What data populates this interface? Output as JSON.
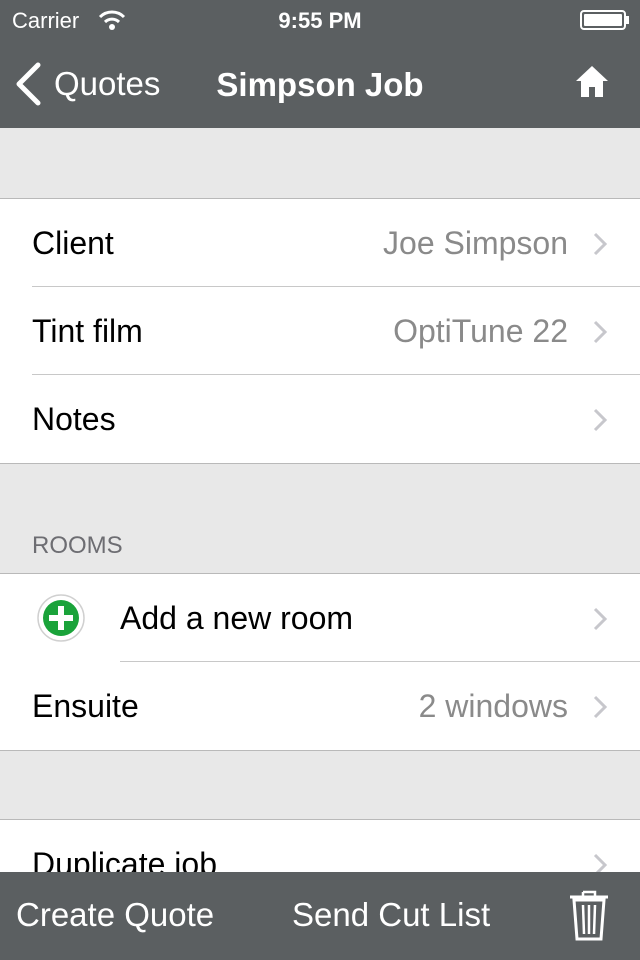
{
  "status_bar": {
    "carrier": "Carrier",
    "time": "9:55 PM"
  },
  "nav": {
    "back_label": "Quotes",
    "title": "Simpson Job"
  },
  "details": [
    {
      "label": "Client",
      "value": "Joe Simpson"
    },
    {
      "label": "Tint film",
      "value": "OptiTune 22"
    },
    {
      "label": "Notes",
      "value": ""
    }
  ],
  "rooms": {
    "header": "ROOMS",
    "add_label": "Add a new room",
    "items": [
      {
        "label": "Ensuite",
        "value": "2 windows"
      }
    ]
  },
  "actions": [
    {
      "label": "Duplicate job"
    }
  ],
  "toolbar": {
    "create_quote": "Create Quote",
    "send_cut_list": "Send Cut List"
  },
  "icons": [
    "wifi-icon",
    "battery-icon",
    "back-chevron-icon",
    "home-icon",
    "chevron-right-icon",
    "add-circle-icon",
    "trash-icon"
  ],
  "colors": {
    "bar": "#5b5f61",
    "background": "#e8e8e8",
    "add_green": "#1aa33a",
    "value_gray": "#8a8a8a"
  }
}
